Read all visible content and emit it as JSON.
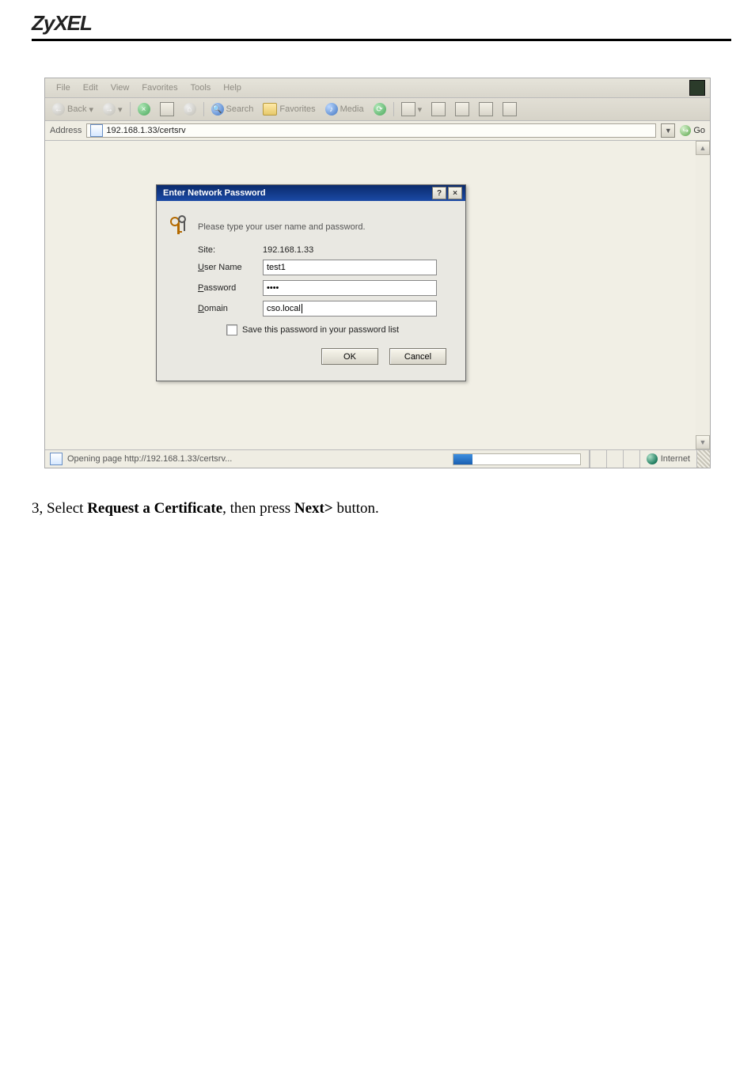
{
  "brand": "ZyXEL",
  "menu": {
    "file": "File",
    "edit": "Edit",
    "view": "View",
    "favorites": "Favorites",
    "tools": "Tools",
    "help": "Help"
  },
  "toolbar": {
    "back": "Back",
    "search": "Search",
    "favorites": "Favorites",
    "media": "Media"
  },
  "addressbar": {
    "label": "Address",
    "url": "192.168.1.33/certsrv",
    "go": "Go"
  },
  "dialog": {
    "title": "Enter Network Password",
    "prompt": "Please type your user name and password.",
    "site_label": "Site:",
    "site_value": "192.168.1.33",
    "user_prefix": "U",
    "user_suffix": "ser Name",
    "user_value": "test1",
    "password_prefix": "P",
    "password_suffix": "assword",
    "password_value": "••••",
    "domain_prefix": "D",
    "domain_suffix": "omain",
    "domain_value": "cso.local",
    "save_prefix": "S",
    "save_suffix": "ave this password in your password list",
    "ok": "OK",
    "cancel": "Cancel",
    "help_btn": "?",
    "close_btn": "×"
  },
  "statusbar": {
    "text": "Opening page http://192.168.1.33/certsrv...",
    "zone": "Internet"
  },
  "instruction": {
    "p1a": "3, Select ",
    "p1b": "Request a Certificate",
    "p1c": ", then press ",
    "p1d": "Next>",
    "p1e": " button."
  }
}
